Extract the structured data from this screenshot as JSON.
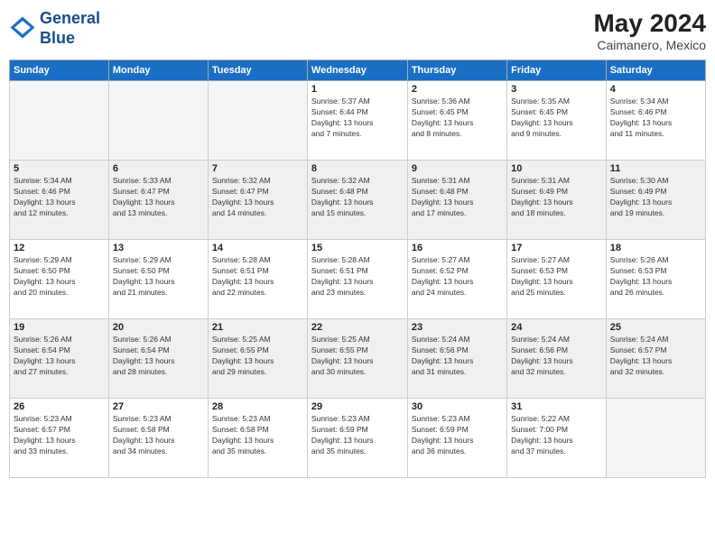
{
  "header": {
    "logo_line1": "General",
    "logo_line2": "Blue",
    "month_year": "May 2024",
    "location": "Caimanero, Mexico"
  },
  "days_of_week": [
    "Sunday",
    "Monday",
    "Tuesday",
    "Wednesday",
    "Thursday",
    "Friday",
    "Saturday"
  ],
  "weeks": [
    [
      {
        "day": "",
        "info": ""
      },
      {
        "day": "",
        "info": ""
      },
      {
        "day": "",
        "info": ""
      },
      {
        "day": "1",
        "info": "Sunrise: 5:37 AM\nSunset: 6:44 PM\nDaylight: 13 hours\nand 7 minutes."
      },
      {
        "day": "2",
        "info": "Sunrise: 5:36 AM\nSunset: 6:45 PM\nDaylight: 13 hours\nand 8 minutes."
      },
      {
        "day": "3",
        "info": "Sunrise: 5:35 AM\nSunset: 6:45 PM\nDaylight: 13 hours\nand 9 minutes."
      },
      {
        "day": "4",
        "info": "Sunrise: 5:34 AM\nSunset: 6:46 PM\nDaylight: 13 hours\nand 11 minutes."
      }
    ],
    [
      {
        "day": "5",
        "info": "Sunrise: 5:34 AM\nSunset: 6:46 PM\nDaylight: 13 hours\nand 12 minutes."
      },
      {
        "day": "6",
        "info": "Sunrise: 5:33 AM\nSunset: 6:47 PM\nDaylight: 13 hours\nand 13 minutes."
      },
      {
        "day": "7",
        "info": "Sunrise: 5:32 AM\nSunset: 6:47 PM\nDaylight: 13 hours\nand 14 minutes."
      },
      {
        "day": "8",
        "info": "Sunrise: 5:32 AM\nSunset: 6:48 PM\nDaylight: 13 hours\nand 15 minutes."
      },
      {
        "day": "9",
        "info": "Sunrise: 5:31 AM\nSunset: 6:48 PM\nDaylight: 13 hours\nand 17 minutes."
      },
      {
        "day": "10",
        "info": "Sunrise: 5:31 AM\nSunset: 6:49 PM\nDaylight: 13 hours\nand 18 minutes."
      },
      {
        "day": "11",
        "info": "Sunrise: 5:30 AM\nSunset: 6:49 PM\nDaylight: 13 hours\nand 19 minutes."
      }
    ],
    [
      {
        "day": "12",
        "info": "Sunrise: 5:29 AM\nSunset: 6:50 PM\nDaylight: 13 hours\nand 20 minutes."
      },
      {
        "day": "13",
        "info": "Sunrise: 5:29 AM\nSunset: 6:50 PM\nDaylight: 13 hours\nand 21 minutes."
      },
      {
        "day": "14",
        "info": "Sunrise: 5:28 AM\nSunset: 6:51 PM\nDaylight: 13 hours\nand 22 minutes."
      },
      {
        "day": "15",
        "info": "Sunrise: 5:28 AM\nSunset: 6:51 PM\nDaylight: 13 hours\nand 23 minutes."
      },
      {
        "day": "16",
        "info": "Sunrise: 5:27 AM\nSunset: 6:52 PM\nDaylight: 13 hours\nand 24 minutes."
      },
      {
        "day": "17",
        "info": "Sunrise: 5:27 AM\nSunset: 6:53 PM\nDaylight: 13 hours\nand 25 minutes."
      },
      {
        "day": "18",
        "info": "Sunrise: 5:26 AM\nSunset: 6:53 PM\nDaylight: 13 hours\nand 26 minutes."
      }
    ],
    [
      {
        "day": "19",
        "info": "Sunrise: 5:26 AM\nSunset: 6:54 PM\nDaylight: 13 hours\nand 27 minutes."
      },
      {
        "day": "20",
        "info": "Sunrise: 5:26 AM\nSunset: 6:54 PM\nDaylight: 13 hours\nand 28 minutes."
      },
      {
        "day": "21",
        "info": "Sunrise: 5:25 AM\nSunset: 6:55 PM\nDaylight: 13 hours\nand 29 minutes."
      },
      {
        "day": "22",
        "info": "Sunrise: 5:25 AM\nSunset: 6:55 PM\nDaylight: 13 hours\nand 30 minutes."
      },
      {
        "day": "23",
        "info": "Sunrise: 5:24 AM\nSunset: 6:56 PM\nDaylight: 13 hours\nand 31 minutes."
      },
      {
        "day": "24",
        "info": "Sunrise: 5:24 AM\nSunset: 6:56 PM\nDaylight: 13 hours\nand 32 minutes."
      },
      {
        "day": "25",
        "info": "Sunrise: 5:24 AM\nSunset: 6:57 PM\nDaylight: 13 hours\nand 32 minutes."
      }
    ],
    [
      {
        "day": "26",
        "info": "Sunrise: 5:23 AM\nSunset: 6:57 PM\nDaylight: 13 hours\nand 33 minutes."
      },
      {
        "day": "27",
        "info": "Sunrise: 5:23 AM\nSunset: 6:58 PM\nDaylight: 13 hours\nand 34 minutes."
      },
      {
        "day": "28",
        "info": "Sunrise: 5:23 AM\nSunset: 6:58 PM\nDaylight: 13 hours\nand 35 minutes."
      },
      {
        "day": "29",
        "info": "Sunrise: 5:23 AM\nSunset: 6:59 PM\nDaylight: 13 hours\nand 35 minutes."
      },
      {
        "day": "30",
        "info": "Sunrise: 5:23 AM\nSunset: 6:59 PM\nDaylight: 13 hours\nand 36 minutes."
      },
      {
        "day": "31",
        "info": "Sunrise: 5:22 AM\nSunset: 7:00 PM\nDaylight: 13 hours\nand 37 minutes."
      },
      {
        "day": "",
        "info": ""
      }
    ]
  ]
}
